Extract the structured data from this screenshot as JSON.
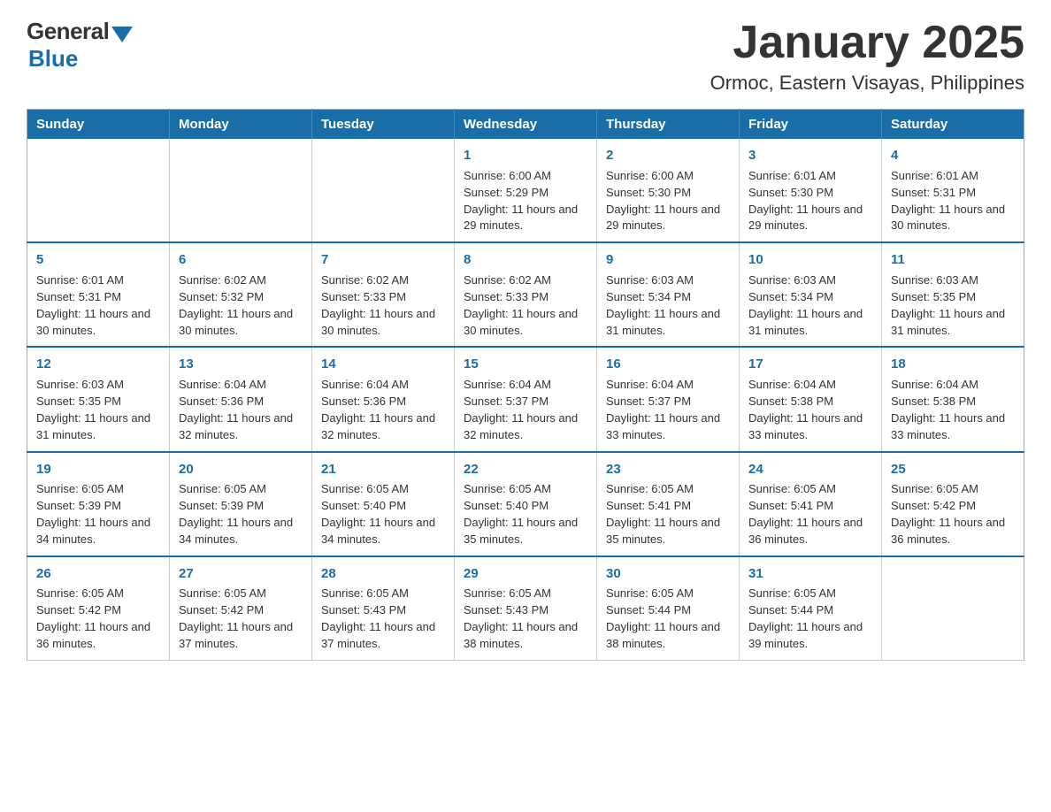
{
  "logo": {
    "general": "General",
    "blue": "Blue"
  },
  "title": {
    "month": "January 2025",
    "location": "Ormoc, Eastern Visayas, Philippines"
  },
  "weekdays": [
    "Sunday",
    "Monday",
    "Tuesday",
    "Wednesday",
    "Thursday",
    "Friday",
    "Saturday"
  ],
  "weeks": [
    [
      {
        "day": "",
        "info": ""
      },
      {
        "day": "",
        "info": ""
      },
      {
        "day": "",
        "info": ""
      },
      {
        "day": "1",
        "info": "Sunrise: 6:00 AM\nSunset: 5:29 PM\nDaylight: 11 hours and 29 minutes."
      },
      {
        "day": "2",
        "info": "Sunrise: 6:00 AM\nSunset: 5:30 PM\nDaylight: 11 hours and 29 minutes."
      },
      {
        "day": "3",
        "info": "Sunrise: 6:01 AM\nSunset: 5:30 PM\nDaylight: 11 hours and 29 minutes."
      },
      {
        "day": "4",
        "info": "Sunrise: 6:01 AM\nSunset: 5:31 PM\nDaylight: 11 hours and 30 minutes."
      }
    ],
    [
      {
        "day": "5",
        "info": "Sunrise: 6:01 AM\nSunset: 5:31 PM\nDaylight: 11 hours and 30 minutes."
      },
      {
        "day": "6",
        "info": "Sunrise: 6:02 AM\nSunset: 5:32 PM\nDaylight: 11 hours and 30 minutes."
      },
      {
        "day": "7",
        "info": "Sunrise: 6:02 AM\nSunset: 5:33 PM\nDaylight: 11 hours and 30 minutes."
      },
      {
        "day": "8",
        "info": "Sunrise: 6:02 AM\nSunset: 5:33 PM\nDaylight: 11 hours and 30 minutes."
      },
      {
        "day": "9",
        "info": "Sunrise: 6:03 AM\nSunset: 5:34 PM\nDaylight: 11 hours and 31 minutes."
      },
      {
        "day": "10",
        "info": "Sunrise: 6:03 AM\nSunset: 5:34 PM\nDaylight: 11 hours and 31 minutes."
      },
      {
        "day": "11",
        "info": "Sunrise: 6:03 AM\nSunset: 5:35 PM\nDaylight: 11 hours and 31 minutes."
      }
    ],
    [
      {
        "day": "12",
        "info": "Sunrise: 6:03 AM\nSunset: 5:35 PM\nDaylight: 11 hours and 31 minutes."
      },
      {
        "day": "13",
        "info": "Sunrise: 6:04 AM\nSunset: 5:36 PM\nDaylight: 11 hours and 32 minutes."
      },
      {
        "day": "14",
        "info": "Sunrise: 6:04 AM\nSunset: 5:36 PM\nDaylight: 11 hours and 32 minutes."
      },
      {
        "day": "15",
        "info": "Sunrise: 6:04 AM\nSunset: 5:37 PM\nDaylight: 11 hours and 32 minutes."
      },
      {
        "day": "16",
        "info": "Sunrise: 6:04 AM\nSunset: 5:37 PM\nDaylight: 11 hours and 33 minutes."
      },
      {
        "day": "17",
        "info": "Sunrise: 6:04 AM\nSunset: 5:38 PM\nDaylight: 11 hours and 33 minutes."
      },
      {
        "day": "18",
        "info": "Sunrise: 6:04 AM\nSunset: 5:38 PM\nDaylight: 11 hours and 33 minutes."
      }
    ],
    [
      {
        "day": "19",
        "info": "Sunrise: 6:05 AM\nSunset: 5:39 PM\nDaylight: 11 hours and 34 minutes."
      },
      {
        "day": "20",
        "info": "Sunrise: 6:05 AM\nSunset: 5:39 PM\nDaylight: 11 hours and 34 minutes."
      },
      {
        "day": "21",
        "info": "Sunrise: 6:05 AM\nSunset: 5:40 PM\nDaylight: 11 hours and 34 minutes."
      },
      {
        "day": "22",
        "info": "Sunrise: 6:05 AM\nSunset: 5:40 PM\nDaylight: 11 hours and 35 minutes."
      },
      {
        "day": "23",
        "info": "Sunrise: 6:05 AM\nSunset: 5:41 PM\nDaylight: 11 hours and 35 minutes."
      },
      {
        "day": "24",
        "info": "Sunrise: 6:05 AM\nSunset: 5:41 PM\nDaylight: 11 hours and 36 minutes."
      },
      {
        "day": "25",
        "info": "Sunrise: 6:05 AM\nSunset: 5:42 PM\nDaylight: 11 hours and 36 minutes."
      }
    ],
    [
      {
        "day": "26",
        "info": "Sunrise: 6:05 AM\nSunset: 5:42 PM\nDaylight: 11 hours and 36 minutes."
      },
      {
        "day": "27",
        "info": "Sunrise: 6:05 AM\nSunset: 5:42 PM\nDaylight: 11 hours and 37 minutes."
      },
      {
        "day": "28",
        "info": "Sunrise: 6:05 AM\nSunset: 5:43 PM\nDaylight: 11 hours and 37 minutes."
      },
      {
        "day": "29",
        "info": "Sunrise: 6:05 AM\nSunset: 5:43 PM\nDaylight: 11 hours and 38 minutes."
      },
      {
        "day": "30",
        "info": "Sunrise: 6:05 AM\nSunset: 5:44 PM\nDaylight: 11 hours and 38 minutes."
      },
      {
        "day": "31",
        "info": "Sunrise: 6:05 AM\nSunset: 5:44 PM\nDaylight: 11 hours and 39 minutes."
      },
      {
        "day": "",
        "info": ""
      }
    ]
  ]
}
